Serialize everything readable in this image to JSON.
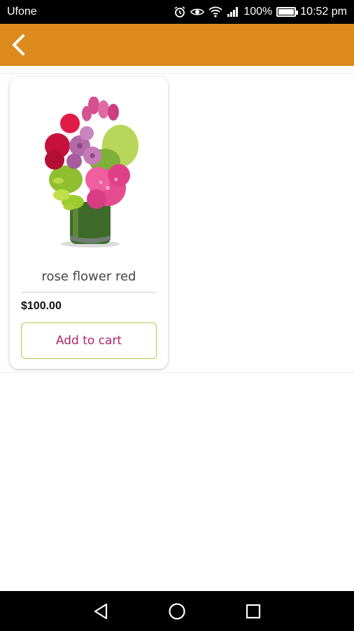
{
  "status_bar": {
    "carrier": "Ufone",
    "battery_text": "100%",
    "time": "10:52 pm",
    "icons": [
      "alarm-icon",
      "eye-icon",
      "wifi-icon",
      "signal-icon",
      "battery-icon"
    ]
  },
  "app_bar": {
    "color": "#DD8A1D",
    "back_icon": "chevron-left-icon"
  },
  "product": {
    "name": "rose flower red",
    "price": "$100.00",
    "button_label": "Add to cart",
    "image": "flower-bouquet-image"
  },
  "nav_bar": {
    "icons": [
      "back-triangle-icon",
      "home-circle-icon",
      "recents-square-icon"
    ]
  }
}
